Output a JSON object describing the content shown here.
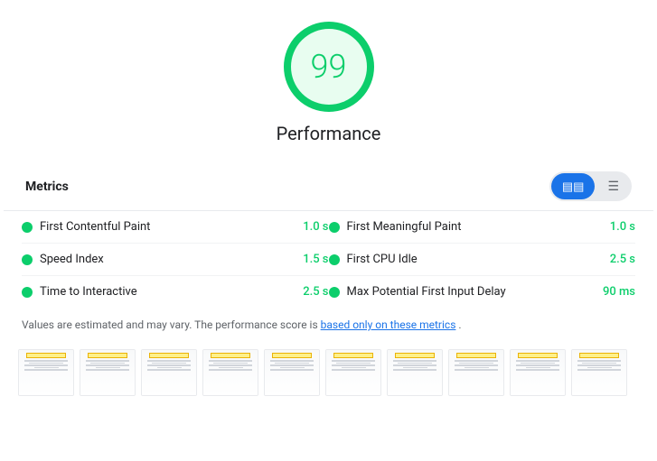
{
  "score": {
    "value": "99",
    "label": "Performance"
  },
  "metrics_section": {
    "title": "Metrics",
    "toggle": {
      "grid_label": "grid-view",
      "list_label": "list-view"
    }
  },
  "metrics": [
    {
      "name": "First Contentful Paint",
      "value": "1.0 s",
      "color": "green",
      "col": "left"
    },
    {
      "name": "First Meaningful Paint",
      "value": "1.0 s",
      "color": "green",
      "col": "right"
    },
    {
      "name": "Speed Index",
      "value": "1.5 s",
      "color": "green",
      "col": "left"
    },
    {
      "name": "First CPU Idle",
      "value": "2.5 s",
      "color": "green",
      "col": "right"
    },
    {
      "name": "Time to Interactive",
      "value": "2.5 s",
      "color": "green",
      "col": "left"
    },
    {
      "name": "Max Potential First Input Delay",
      "value": "90 ms",
      "color": "green",
      "col": "right"
    }
  ],
  "disclaimer": {
    "text_before": "Values are estimated and may vary. The performance score is ",
    "link_text": "based only on these metrics",
    "text_after": "."
  },
  "thumbnails_count": 10
}
